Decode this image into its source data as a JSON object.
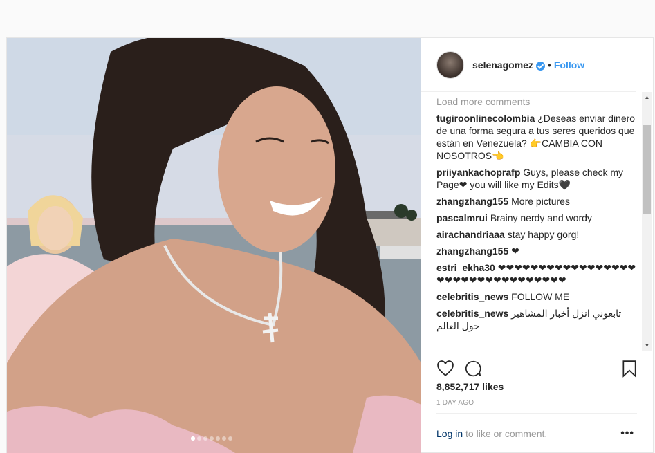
{
  "post": {
    "username": "selenagomez",
    "separator": "•",
    "follow_label": "Follow",
    "load_more_label": "Load more comments",
    "comments": [
      {
        "user": "tugiroonlinecolombia",
        "text": "¿Deseas enviar dinero de una forma segura a tus seres queridos que están en Venezuela? 👉CAMBIA CON NOSOTROS👈"
      },
      {
        "user": "priiyankachoprafp",
        "text": "Guys, please check my Page❤ you will like my Edits🖤"
      },
      {
        "user": "zhangzhang155",
        "text": "More pictures"
      },
      {
        "user": "pascalmrui",
        "text": "Brainy nerdy and wordy"
      },
      {
        "user": "airachandriaaa",
        "text": "stay happy gorg!"
      },
      {
        "user": "zhangzhang155",
        "text": "❤"
      },
      {
        "user": "estri_ekha30",
        "text": "❤❤❤❤❤❤❤❤❤❤❤❤❤❤❤❤❤❤❤❤❤❤❤❤❤❤❤❤❤❤❤❤❤"
      },
      {
        "user": "celebritis_news",
        "text": "FOLLOW ME"
      },
      {
        "user": "celebritis_news",
        "text": "تابعوني انزل أخبار المشاهير حول العالم"
      }
    ],
    "likes": "8,852,717 likes",
    "time": "1 DAY AGO",
    "login_link": "Log in",
    "login_rest": " to like or comment.",
    "more_label": "•••",
    "carousel": {
      "count": 7,
      "active_index": 0
    }
  },
  "scrollbar": {
    "up": "▲",
    "down": "▼"
  },
  "icons": [
    "heart-icon",
    "comment-icon",
    "bookmark-icon",
    "verified-badge-icon"
  ],
  "colors": {
    "link": "#3897f0",
    "login_link": "#003569",
    "muted": "#999999"
  }
}
